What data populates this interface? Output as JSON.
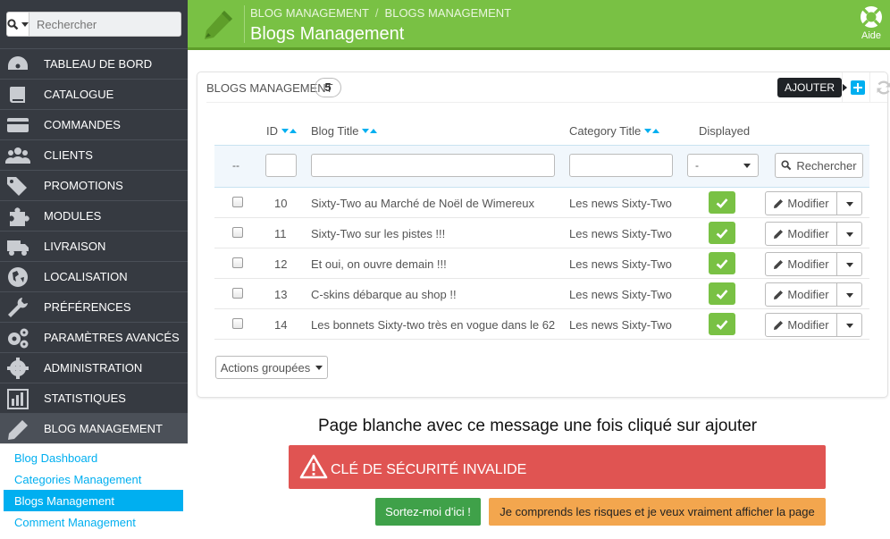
{
  "search": {
    "placeholder": "Rechercher"
  },
  "nav": [
    {
      "label": "TABLEAU DE BORD",
      "icon": "dashboard-icon"
    },
    {
      "label": "CATALOGUE",
      "icon": "book-icon"
    },
    {
      "label": "COMMANDES",
      "icon": "credit-card-icon"
    },
    {
      "label": "CLIENTS",
      "icon": "users-icon"
    },
    {
      "label": "PROMOTIONS",
      "icon": "tags-icon"
    },
    {
      "label": "MODULES",
      "icon": "puzzle-icon"
    },
    {
      "label": "LIVRAISON",
      "icon": "truck-icon"
    },
    {
      "label": "LOCALISATION",
      "icon": "globe-icon"
    },
    {
      "label": "PRÉFÉRENCES",
      "icon": "wrench-icon"
    },
    {
      "label": "PARAMÈTRES AVANCÉS",
      "icon": "cogs-icon"
    },
    {
      "label": "ADMINISTRATION",
      "icon": "gear-icon"
    },
    {
      "label": "STATISTIQUES",
      "icon": "bar-chart-icon"
    },
    {
      "label": "BLOG MANAGEMENT",
      "icon": "pencil-icon"
    }
  ],
  "subnav": [
    {
      "label": "Blog Dashboard"
    },
    {
      "label": "Categories Management"
    },
    {
      "label": "Blogs Management"
    },
    {
      "label": "Comment Management"
    }
  ],
  "header": {
    "breadcrumb_1": "BLOG MANAGEMENT",
    "breadcrumb_sep": "/",
    "breadcrumb_2": "BLOGS MANAGEMENT",
    "title": "Blogs Management",
    "help_label": "Aide"
  },
  "panel": {
    "title": "BLOGS MANAGEMENT",
    "count": "5",
    "add_tooltip": "AJOUTER",
    "columns": {
      "id": "ID",
      "blog_title": "Blog Title",
      "category_title": "Category Title",
      "displayed": "Displayed"
    },
    "filter": {
      "dash": "--",
      "displayed_value": "-",
      "search_label": "Rechercher"
    },
    "rows": [
      {
        "id": "10",
        "title": "Sixty-Two au Marché de Noël de Wimereux",
        "category": "Les news Sixty-Two",
        "edit": "Modifier"
      },
      {
        "id": "11",
        "title": "Sixty-Two sur les pistes !!!",
        "category": "Les news Sixty-Two",
        "edit": "Modifier"
      },
      {
        "id": "12",
        "title": "Et oui, on ouvre demain !!!",
        "category": "Les news Sixty-Two",
        "edit": "Modifier"
      },
      {
        "id": "13",
        "title": "C-skins débarque au shop !!",
        "category": "Les news Sixty-Two",
        "edit": "Modifier"
      },
      {
        "id": "14",
        "title": "Les bonnets Sixty-two très en vogue dans le 62",
        "category": "Les news Sixty-Two",
        "edit": "Modifier"
      }
    ],
    "bulk_label": "Actions groupées"
  },
  "message": {
    "caption": "Page blanche avec ce message une fois cliqué sur ajouter",
    "alert_text": "CLÉ DE SÉCURITÉ INVALIDE",
    "leave_button": "Sortez-moi d'ici !",
    "proceed_button": "Je comprends les risques et je veux vraiment afficher la page"
  },
  "colors": {
    "header_green": "#79c144",
    "sidebar": "#363a41",
    "accent_blue": "#00aff0",
    "alert_red": "#e05452",
    "btn_green": "#3fa149",
    "btn_orange": "#f3a64e"
  }
}
